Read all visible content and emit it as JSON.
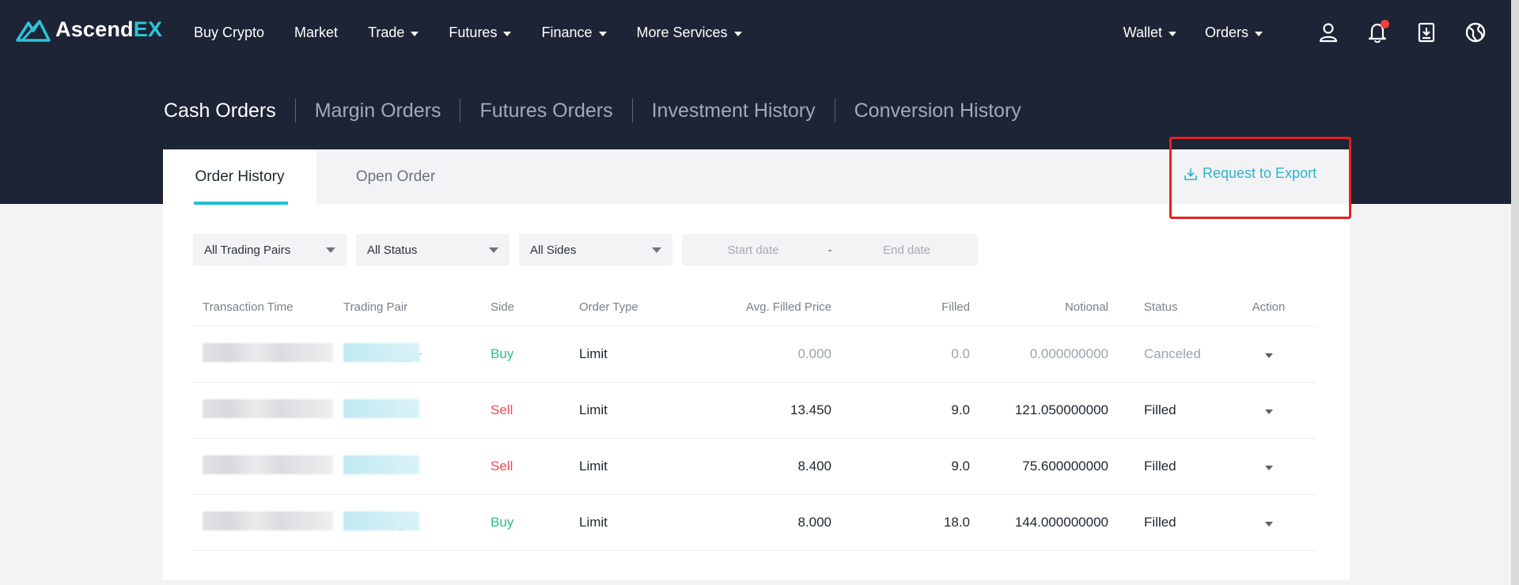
{
  "brand": {
    "name_prefix": "Ascend",
    "name_suffix": "EX"
  },
  "nav": {
    "items": [
      {
        "label": "Buy Crypto",
        "has_caret": false
      },
      {
        "label": "Market",
        "has_caret": false
      },
      {
        "label": "Trade",
        "has_caret": true
      },
      {
        "label": "Futures",
        "has_caret": true
      },
      {
        "label": "Finance",
        "has_caret": true
      },
      {
        "label": "More Services",
        "has_caret": true
      }
    ],
    "right_items": [
      {
        "label": "Wallet"
      },
      {
        "label": "Orders"
      }
    ],
    "icons": [
      "user-icon",
      "bell-icon",
      "download-icon",
      "globe-icon"
    ]
  },
  "section_tabs": [
    {
      "label": "Cash Orders",
      "active": true
    },
    {
      "label": "Margin Orders",
      "active": false
    },
    {
      "label": "Futures Orders",
      "active": false
    },
    {
      "label": "Investment History",
      "active": false
    },
    {
      "label": "Conversion History",
      "active": false
    }
  ],
  "card_tabs": {
    "active": "Order History",
    "inactive": "Open Order"
  },
  "export_label": "Request to Export",
  "filters": {
    "trading_pairs": "All Trading Pairs",
    "status": "All Status",
    "sides": "All Sides",
    "start_placeholder": "Start date",
    "end_placeholder": "End date",
    "separator": "-"
  },
  "table": {
    "headers": {
      "time": "Transaction Time",
      "pair": "Trading Pair",
      "side": "Side",
      "type": "Order Type",
      "avg": "Avg. Filled Price",
      "filled": "Filled",
      "notional": "Notional",
      "status": "Status",
      "action": "Action"
    },
    "rows": [
      {
        "pair_suffix": "USDT",
        "side": "Buy",
        "type": "Limit",
        "avg": "0.000",
        "filled": "0.0",
        "notional": "0.000000000",
        "status": "Canceled"
      },
      {
        "pair_suffix": "",
        "side": "Sell",
        "type": "Limit",
        "avg": "13.450",
        "filled": "9.0",
        "notional": "121.050000000",
        "status": "Filled"
      },
      {
        "pair_suffix": "",
        "side": "Sell",
        "type": "Limit",
        "avg": "8.400",
        "filled": "9.0",
        "notional": "75.600000000",
        "status": "Filled"
      },
      {
        "pair_suffix": "SDT",
        "side": "Buy",
        "type": "Limit",
        "avg": "8.000",
        "filled": "18.0",
        "notional": "144.000000000",
        "status": "Filled"
      }
    ]
  },
  "colors": {
    "header_bg": "#1c2436",
    "accent": "#23bfd4",
    "buy": "#2cc18a",
    "sell": "#f0494f",
    "highlight": "#e8201e"
  }
}
